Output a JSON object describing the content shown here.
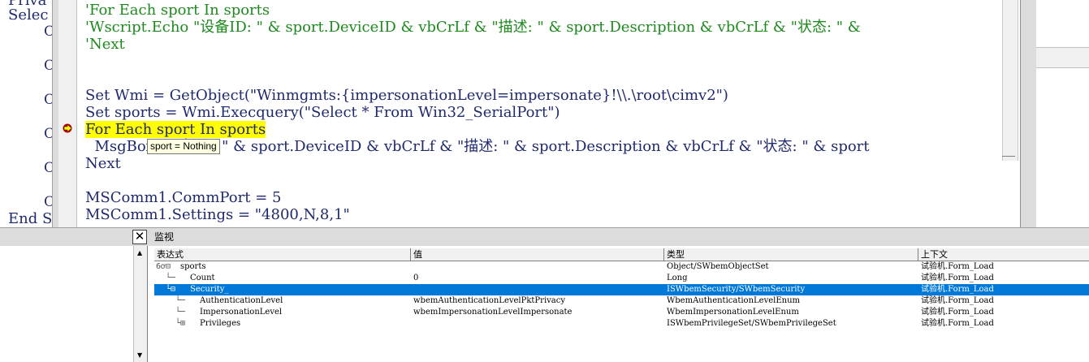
{
  "bg_window": {
    "lines": [
      "Priva",
      "Selec",
      "End S"
    ],
    "c_marks": [
      "C",
      "C",
      "C",
      "C",
      "C",
      "C",
      "C"
    ]
  },
  "code": {
    "lines": [
      {
        "text": "'For Each sport In sports",
        "kind": "comment"
      },
      {
        "text": "'Wscript.Echo \"设备ID: \" & sport.DeviceID & vbCrLf & \"描述: \" & sport.Description & vbCrLf & \"状态: \" &",
        "kind": "comment"
      },
      {
        "text": "'Next",
        "kind": "comment"
      },
      {
        "text": "",
        "kind": "code"
      },
      {
        "text": "",
        "kind": "code"
      },
      {
        "text": "Set Wmi = GetObject(\"Winmgmts:{impersonationLevel=impersonate}!\\\\.\\root\\cimv2\")",
        "kind": "code"
      },
      {
        "text": "Set sports = Wmi.Execquery(\"Select * From Win32_SerialPort\")",
        "kind": "code"
      },
      {
        "text": "For Each sport In sports",
        "kind": "current"
      },
      {
        "text": "  MsgBox \"设备ID: \" & sport.DeviceID & vbCrLf & \"描述: \" & sport.Description & vbCrLf & \"状态: \" & sport",
        "kind": "code"
      },
      {
        "text": "Next",
        "kind": "code"
      },
      {
        "text": "",
        "kind": "code"
      },
      {
        "text": "MSComm1.CommPort = 5",
        "kind": "code"
      },
      {
        "text": "MSComm1.Settings = \"4800,N,8,1\"",
        "kind": "code"
      }
    ],
    "tooltip": "sport = Nothing"
  },
  "watch": {
    "title": "监视",
    "close": "✕",
    "columns": [
      "表达式",
      "值",
      "类型",
      "上下文"
    ],
    "rows": [
      {
        "tree": "6ơ⊟",
        "expr": "sports",
        "value": "",
        "type": "Object/SWbemObjectSet",
        "context": "试验机.Form_Load",
        "selected": false,
        "indent": 0
      },
      {
        "tree": "└─",
        "expr": "Count",
        "value": "0",
        "type": "Long",
        "context": "试验机.Form_Load",
        "selected": false,
        "indent": 1
      },
      {
        "tree": "└⊟",
        "expr": "Security_",
        "value": "",
        "type": "ISWbemSecurity/SWbemSecurity",
        "context": "试验机.Form_Load",
        "selected": true,
        "indent": 1
      },
      {
        "tree": "└─",
        "expr": "AuthenticationLevel",
        "value": "wbemAuthenticationLevelPktPrivacy",
        "type": "WbemAuthenticationLevelEnum",
        "context": "试验机.Form_Load",
        "selected": false,
        "indent": 2
      },
      {
        "tree": "└─",
        "expr": "ImpersonationLevel",
        "value": "wbemImpersonationLevelImpersonate",
        "type": "WbemImpersonationLevelEnum",
        "context": "试验机.Form_Load",
        "selected": false,
        "indent": 2
      },
      {
        "tree": "└⊞",
        "expr": "Privileges",
        "value": "",
        "type": "ISWbemPrivilegeSet/SWbemPrivilegeSet",
        "context": "试验机.Form_Load",
        "selected": false,
        "indent": 2
      }
    ]
  }
}
